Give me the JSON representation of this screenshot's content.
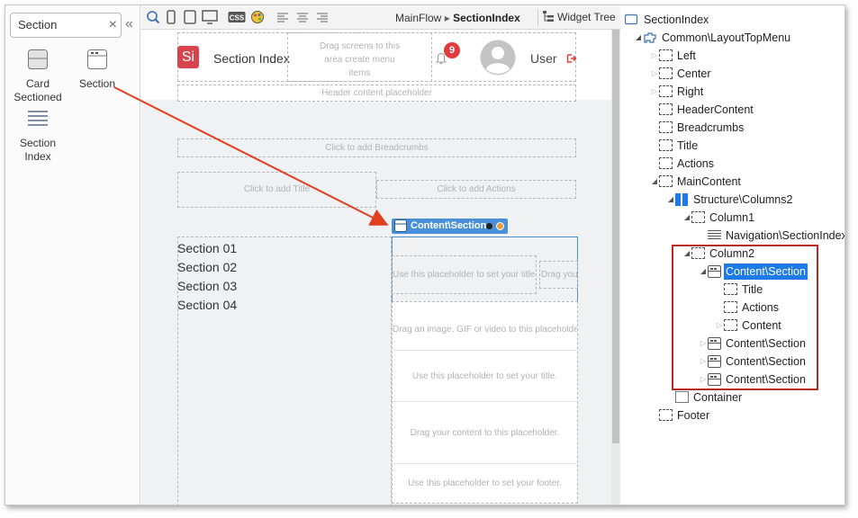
{
  "toolbox": {
    "search_value": "Section",
    "clear_glyph": "×",
    "collapse_glyph": "«",
    "widgets": [
      {
        "label": "Card Sectioned",
        "icon": "card-sectioned-icon"
      },
      {
        "label": "Section",
        "icon": "section-icon"
      },
      {
        "label": "Section Index",
        "icon": "section-index-icon"
      }
    ]
  },
  "toolbar": {
    "flow": "MainFlow",
    "separator": "▸",
    "screen": "SectionIndex",
    "widget_tree_tab": "Widget Tree",
    "css_label": "CSS"
  },
  "canvas": {
    "logo_text": "Si",
    "app_title": "Section Index",
    "drag_screens_text": "Drag screens to this area create menu items",
    "notification_count": "9",
    "user_label": "User",
    "header_content_ph": "Header content placeholder",
    "breadcrumbs_ph": "Click to add Breadcrumbs",
    "title_ph": "Click to add Title",
    "actions_ph": "Click to add Actions",
    "selected_tag": "Content\\Section",
    "sections": [
      "Section 01",
      "Section 02",
      "Section 03",
      "Section 04"
    ],
    "section_title_ph": "Use this placeholder to set your title.",
    "section_drag_ph": "Drag you",
    "image_ph": "Drag an image, GIF or video to this placeholder.",
    "card_title_ph": "Use this placeholder to set your title.",
    "content_ph": "Drag your content to this placeholder.",
    "footer_ph": "Use this placeholder to set your footer."
  },
  "tree": {
    "nodes": [
      {
        "label": "SectionIndex",
        "icon": "screen-icon"
      },
      {
        "label": "Common\\LayoutTopMenu",
        "icon": "layout-block-icon"
      },
      {
        "label": "Left",
        "icon": "placeholder-icon"
      },
      {
        "label": "Center",
        "icon": "placeholder-icon"
      },
      {
        "label": "Right",
        "icon": "placeholder-icon"
      },
      {
        "label": "HeaderContent",
        "icon": "placeholder-icon"
      },
      {
        "label": "Breadcrumbs",
        "icon": "placeholder-icon"
      },
      {
        "label": "Title",
        "icon": "placeholder-icon"
      },
      {
        "label": "Actions",
        "icon": "placeholder-icon"
      },
      {
        "label": "MainContent",
        "icon": "placeholder-icon"
      },
      {
        "label": "Structure\\Columns2",
        "icon": "columns-icon"
      },
      {
        "label": "Column1",
        "icon": "placeholder-icon"
      },
      {
        "label": "Navigation\\SectionIndex",
        "icon": "navigation-icon"
      },
      {
        "label": "Column2",
        "icon": "placeholder-icon"
      },
      {
        "label": "Content\\Section",
        "icon": "section-icon",
        "selected": true
      },
      {
        "label": "Title",
        "icon": "placeholder-icon"
      },
      {
        "label": "Actions",
        "icon": "placeholder-icon"
      },
      {
        "label": "Content",
        "icon": "placeholder-icon"
      },
      {
        "label": "Content\\Section",
        "icon": "section-icon"
      },
      {
        "label": "Content\\Section",
        "icon": "section-icon"
      },
      {
        "label": "Content\\Section",
        "icon": "section-icon"
      },
      {
        "label": "Container",
        "icon": "container-icon"
      },
      {
        "label": "Footer",
        "icon": "placeholder-icon"
      }
    ]
  },
  "colors": {
    "selection": "#1e7ae6",
    "highlight_box": "#b92b1f",
    "arrow": "#e0401f",
    "logo": "#d9434e",
    "badge": "#e23b3b"
  }
}
